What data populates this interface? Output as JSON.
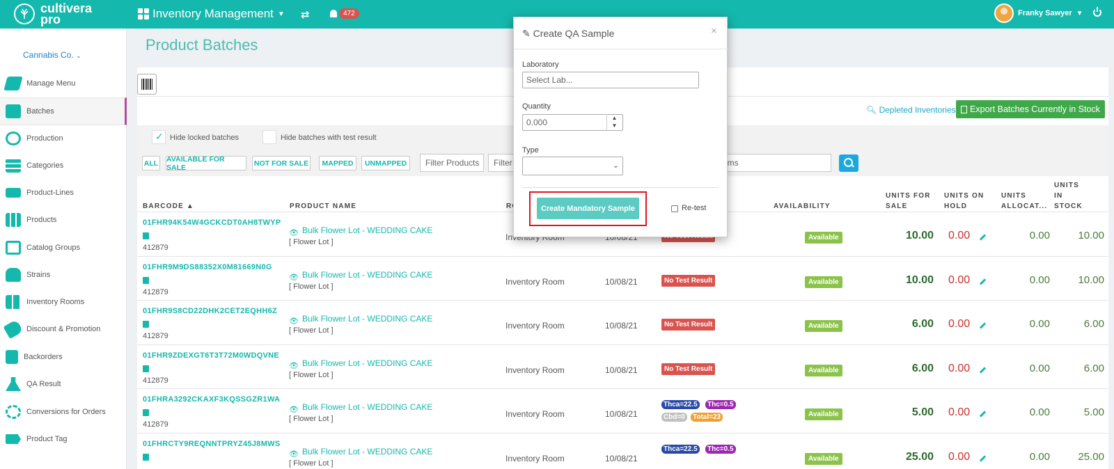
{
  "brand": {
    "line1": "cultivera",
    "line2": "pro"
  },
  "topbar": {
    "module": "Inventory Management",
    "notifications": "472",
    "user": "Franky Sawyer"
  },
  "sidebar": {
    "org": "Cannabis Co.",
    "items": [
      {
        "label": "Manage Menu"
      },
      {
        "label": "Batches"
      },
      {
        "label": "Production"
      },
      {
        "label": "Categories"
      },
      {
        "label": "Product-Lines"
      },
      {
        "label": "Products"
      },
      {
        "label": "Catalog Groups"
      },
      {
        "label": "Strains"
      },
      {
        "label": "Inventory Rooms"
      },
      {
        "label": "Discount & Promotion"
      },
      {
        "label": "Backorders"
      },
      {
        "label": "QA Result"
      },
      {
        "label": "Conversions for Orders"
      },
      {
        "label": "Product Tag"
      }
    ]
  },
  "page": {
    "title": "Product Batches",
    "depleted_link": "Depleted Inventories",
    "export_label": "Export Batches Currently in Stock",
    "hide_locked": "Hide locked batches",
    "hide_tested": "Hide batches with test result",
    "filters": {
      "all": "ALL",
      "afs": "AVAILABLE FOR SALE",
      "nfs": "NOT FOR SALE",
      "mapped": "MAPPED",
      "unmapped": "UNMAPPED"
    },
    "filter_products": "Filter Products",
    "filter_partial": "Filter",
    "filter_rooms_partial": "oms"
  },
  "table": {
    "headers": {
      "barcode": "BARCODE ▲",
      "product": "PRODUCT NAME",
      "room_partial": "RO",
      "availability": "AVAILABILITY",
      "ufs1": "UNITS FOR",
      "ufs2": "SALE",
      "uoh1": "UNITS ON",
      "uoh2": "HOLD",
      "ual1": "UNITS",
      "ual2": "ALLOCAT...",
      "uis1": "UNITS",
      "uis2": "IN",
      "uis3": "STOCK"
    },
    "rows": [
      {
        "barcode": "01FHR94K54W4GCKCDT0AH8TWYP",
        "lot": "412879",
        "product": "Bulk Flower Lot - WEDDING CAKE",
        "type": "[ Flower Lot ]",
        "room": "Inventory Room",
        "date": "10/08/21",
        "test": "No Test Result",
        "avail": "Available",
        "ufs": "10.00",
        "uoh": "0.00",
        "ual": "0.00",
        "uis": "10.00"
      },
      {
        "barcode": "01FHR9M9DS88352X0M81669N0G",
        "lot": "412879",
        "product": "Bulk Flower Lot - WEDDING CAKE",
        "type": "[ Flower Lot ]",
        "room": "Inventory Room",
        "date": "10/08/21",
        "test": "No Test Result",
        "avail": "Available",
        "ufs": "10.00",
        "uoh": "0.00",
        "ual": "0.00",
        "uis": "10.00"
      },
      {
        "barcode": "01FHR9S8CD22DHK2CET2EQHH6Z",
        "lot": "412879",
        "product": "Bulk Flower Lot - WEDDING CAKE",
        "type": "[ Flower Lot ]",
        "room": "Inventory Room",
        "date": "10/08/21",
        "test": "No Test Result",
        "avail": "Available",
        "ufs": "6.00",
        "uoh": "0.00",
        "ual": "0.00",
        "uis": "6.00"
      },
      {
        "barcode": "01FHR9ZDEXGT6T3T72M0WDQVNE",
        "lot": "412879",
        "product": "Bulk Flower Lot - WEDDING CAKE",
        "type": "[ Flower Lot ]",
        "room": "Inventory Room",
        "date": "10/08/21",
        "test": "No Test Result",
        "avail": "Available",
        "ufs": "6.00",
        "uoh": "0.00",
        "ual": "0.00",
        "uis": "6.00"
      },
      {
        "barcode": "01FHRA3292CKAXF3KQSSGZR1WA",
        "lot": "412879",
        "product": "Bulk Flower Lot - WEDDING CAKE",
        "type": "[ Flower Lot ]",
        "room": "Inventory Room",
        "date": "10/08/21",
        "thca": "Thca=22.5",
        "thc": "Thc=0.5",
        "cbd": "Cbd=0",
        "total": "Total=23",
        "avail": "Available",
        "ufs": "5.00",
        "uoh": "0.00",
        "ual": "0.00",
        "uis": "5.00"
      },
      {
        "barcode": "01FHRCTY9REQNNTPRYZ45J8MWS",
        "product": "Bulk Flower Lot - WEDDING CAKE",
        "type": "[ Flower Lot ]",
        "room": "Inventory Room",
        "date": "10/08/21",
        "thca": "Thca=22.5",
        "thc": "Thc=0.5",
        "avail": "Available",
        "ufs": "25.00",
        "uoh": "0.00",
        "ual": "0.00",
        "uis": "25.00"
      }
    ]
  },
  "modal": {
    "title": "Create QA Sample",
    "close": "×",
    "lab_label": "Laboratory",
    "lab_placeholder": "Select Lab...",
    "qty_label": "Quantity",
    "qty_value": "0.000",
    "type_label": "Type",
    "create_label": "Create Mandatory Sample",
    "retest_label": "Re-test"
  },
  "colors": {
    "brand": "#15b8ad",
    "danger": "#d9534f",
    "success": "#8bc34a",
    "export": "#3fa94a"
  }
}
